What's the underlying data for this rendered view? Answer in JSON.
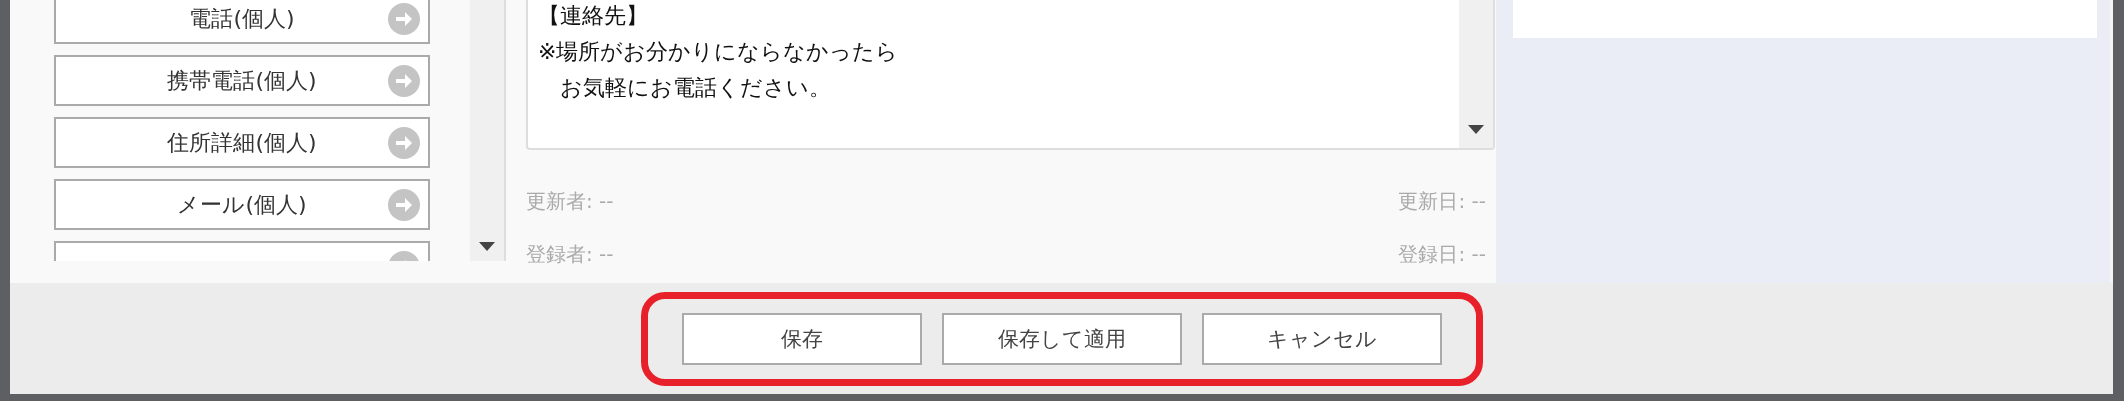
{
  "contact_items": [
    {
      "label": "電話(個人)"
    },
    {
      "label": "携帯電話(個人)"
    },
    {
      "label": "住所詳細(個人)"
    },
    {
      "label": "メール(個人)"
    },
    {
      "cut_off": true
    }
  ],
  "memo": {
    "lines": [
      "【連絡先】",
      "※場所がお分かりにならなかったら",
      "　お気軽にお電話ください。"
    ]
  },
  "meta": [
    {
      "left": "更新者: --",
      "right": "更新日: --"
    },
    {
      "left": "登録者: --",
      "right": "登録日: --"
    }
  ],
  "footer": {
    "highlighted": true,
    "buttons": [
      "保存",
      "保存して適用",
      "キャンセル"
    ]
  }
}
